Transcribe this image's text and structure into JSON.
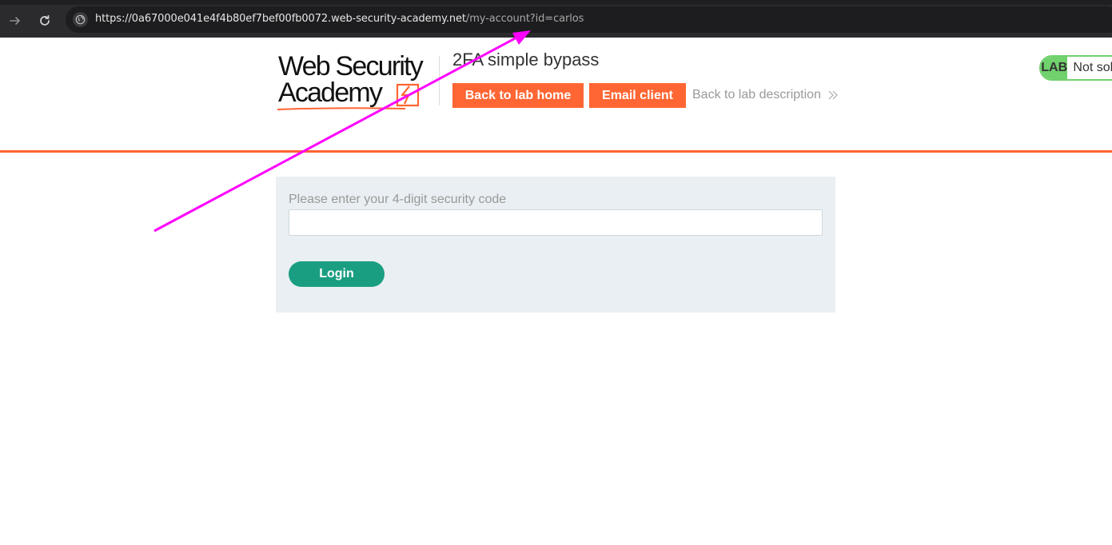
{
  "browser": {
    "url_host": "https://0a67000e041e4f4b80ef7bef00fb0072.web-security-academy.net",
    "url_path": "/my-account?id=carlos",
    "icons": [
      "forward-icon",
      "reload-icon",
      "site-info-icon"
    ]
  },
  "header": {
    "logo_line1": "Web Security",
    "logo_line2": "Academy",
    "lab_title": "2FA simple bypass",
    "back_home_label": "Back to lab home",
    "email_client_label": "Email client",
    "back_desc_label": "Back to lab description",
    "lab_badge": "LAB",
    "lab_status": "Not solved"
  },
  "form": {
    "code_label": "Please enter your 4-digit security code",
    "code_value": "",
    "login_label": "Login"
  },
  "colors": {
    "accent": "#ff6633",
    "login": "#1a9e82",
    "lab_green": "#70d16d",
    "annotation": "#ff00ff",
    "panel_bg": "#e9eff2"
  }
}
